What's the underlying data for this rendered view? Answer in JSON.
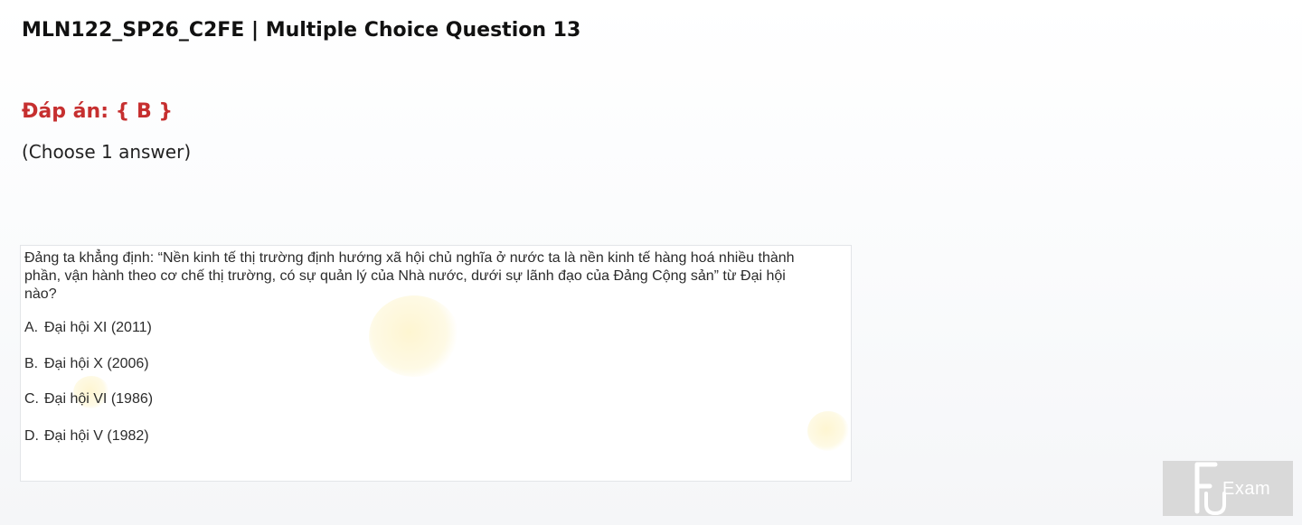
{
  "page": {
    "title": "MLN122_SP26_C2FE | Multiple Choice Question 13",
    "answer": "Đáp án: { B }",
    "instruction": "(Choose 1 answer)"
  },
  "question": {
    "text": "Đảng ta khẳng định: “Nền kinh tế thị trường định hướng xã hội chủ nghĩa ở nước ta là nền kinh tế hàng hoá nhiều thành phần, vận hành theo cơ chế thị trường, có sự quản lý của Nhà nước, dưới sự lãnh đạo của Đảng Cộng sản” từ Đại hội nào?",
    "options": [
      {
        "letter": "A.",
        "text": "Đại hội XI (2011)"
      },
      {
        "letter": "B.",
        "text": "Đại hội X (2006)"
      },
      {
        "letter": "C.",
        "text": "Đại hội VI (1986)"
      },
      {
        "letter": "D.",
        "text": "Đại hội V (1982)"
      }
    ]
  },
  "watermark": {
    "text": "Exam",
    "icon": "fu-logo-icon"
  },
  "colors": {
    "answer": "#c62f2f",
    "title": "#111111",
    "watermark_bg": "#d9d9d9"
  }
}
